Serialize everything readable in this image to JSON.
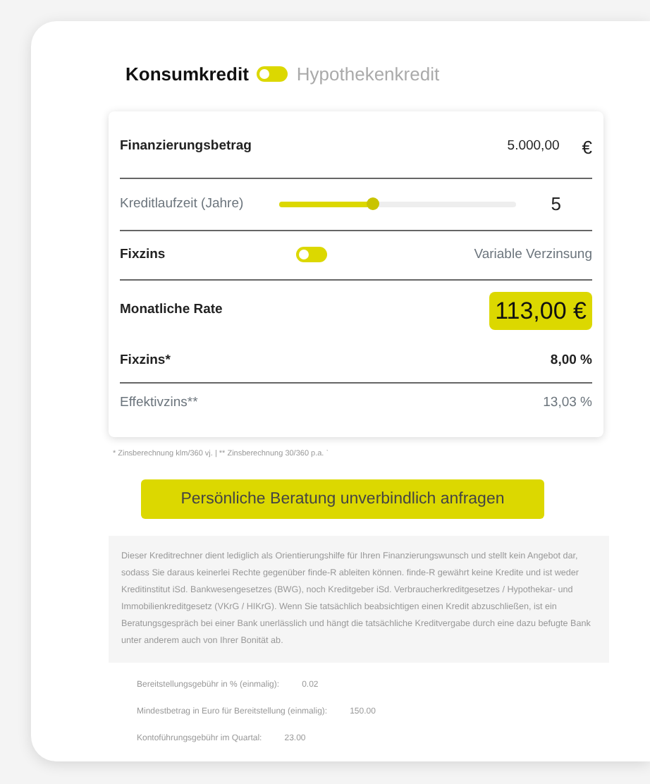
{
  "loan_type": {
    "switch_on": false,
    "options": [
      {
        "label": "Konsumkredit",
        "selected": true
      },
      {
        "label": "Hypothekenkredit",
        "selected": false
      }
    ]
  },
  "calculator": {
    "amount": {
      "label": "Finanzierungsbetrag",
      "value": "5.000,00",
      "unit": "€"
    },
    "term": {
      "label": "Kreditlaufzeit (Jahre)",
      "level": 0.4,
      "value": "5"
    },
    "rate_type": {
      "switch_on": false,
      "options": [
        {
          "label": "Fixzins",
          "selected": true
        },
        {
          "label": "Variable Verzinsung",
          "selected": false
        }
      ]
    },
    "monthly": {
      "label": "Monatliche Rate",
      "value": "113,00 €"
    },
    "rates": [
      {
        "label": "Fixzins*",
        "value": "8,00 %",
        "kind": "strong"
      },
      {
        "label": "Effektivzins**",
        "value": "13,03 %",
        "kind": "muted"
      }
    ]
  },
  "footnote": "* Zinsberechnung klm/360 vj. | ** Zinsberechnung 30/360 p.a. `",
  "cta_button": "Persönliche Beratung unverbindlich anfragen",
  "disclaimer": "Dieser Kreditrechner dient lediglich als Orientierungshilfe für Ihren Finanzierungswunsch und stellt kein Angebot dar, sodass Sie daraus keinerlei Rechte gegenüber finde-R ableiten können. finde-R gewährt keine Kredite und ist weder Kreditinstitut iSd. Bankwesengesetzes (BWG), noch Kreditgeber iSd. Verbraucherkreditgesetzes / Hypothekar- und Immobilienkreditgesetz (VKrG / HIKrG). Wenn Sie tatsächlich beabsichtigen einen Kredit abzuschließen, ist ein Beratungsgespräch bei einer Bank unerlässlich und hängt die tatsächliche Kreditvergabe durch eine dazu befugte Bank unter anderem auch von Ihrer Bonität ab.",
  "fees": [
    {
      "label": "Bereitstellungsgebühr in % (einmalig):",
      "value": "0.02"
    },
    {
      "label": "Mindestbetrag in Euro für Bereitstellung (einmalig):",
      "value": "150.00"
    },
    {
      "label": "Kontoführungsgebühr im Quartal:",
      "value": "23.00"
    }
  ]
}
